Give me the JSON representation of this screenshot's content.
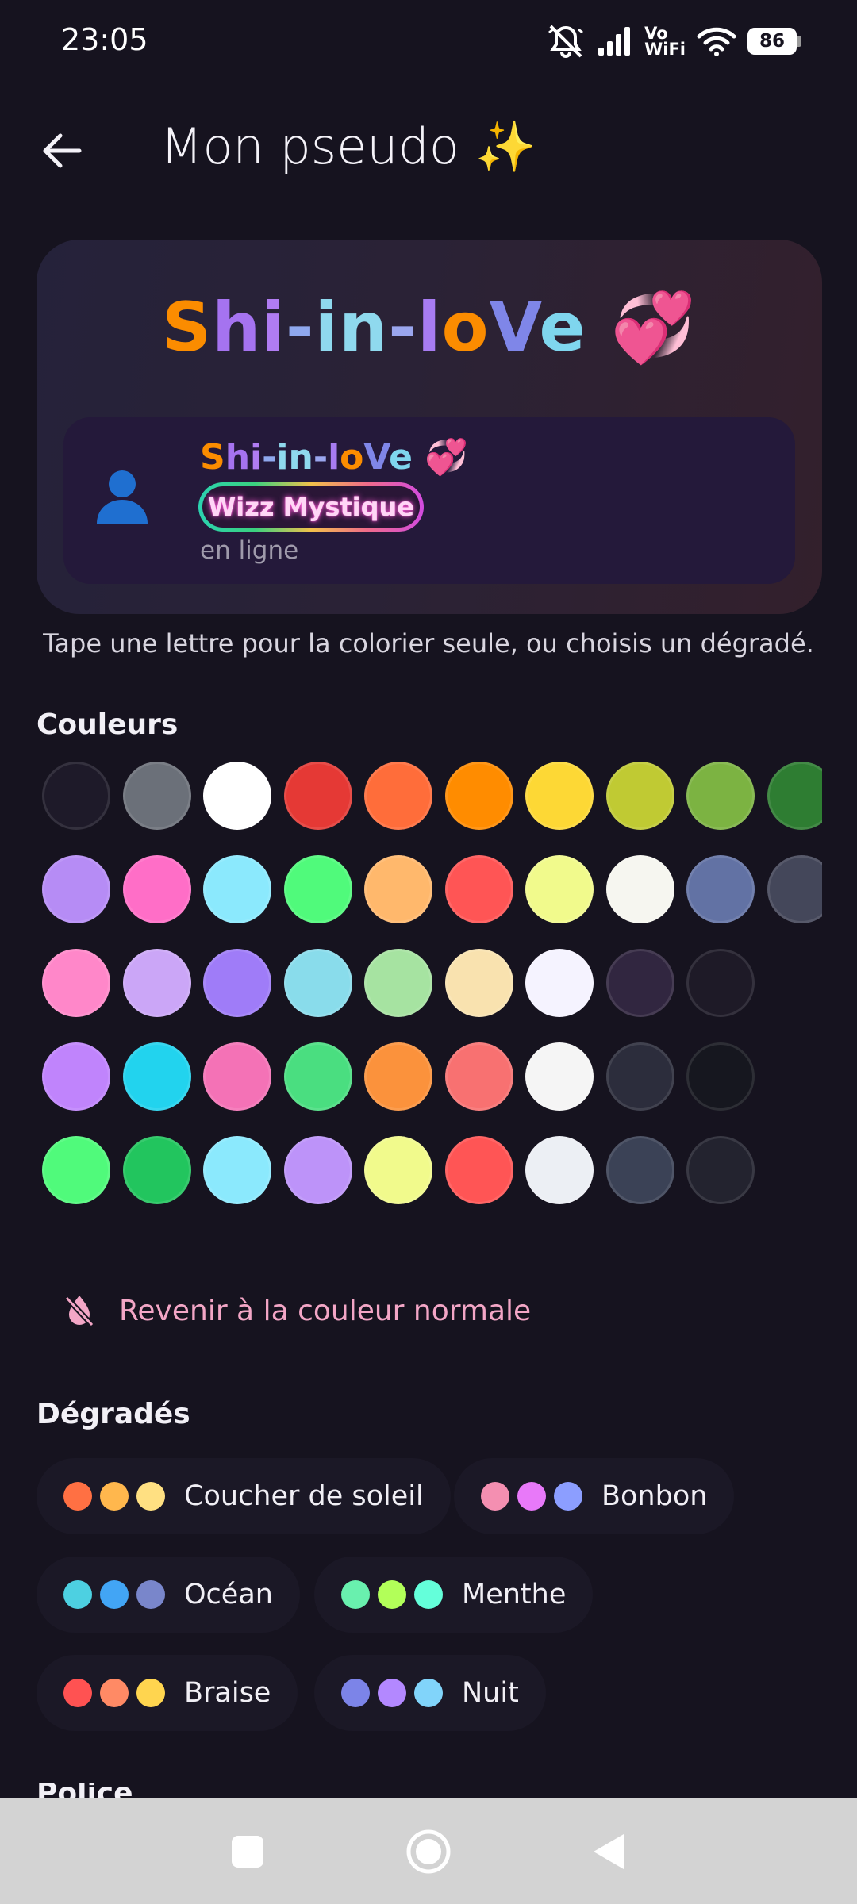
{
  "status_bar": {
    "time": "23:05",
    "volte_top": "Vo",
    "volte_bottom": "WiFi",
    "battery": "86",
    "icons": [
      "mute-icon",
      "signal-icon",
      "wifi-icon",
      "battery-icon"
    ]
  },
  "app_bar": {
    "back_icon": "arrow-left-icon",
    "title": "Mon pseudo ✨"
  },
  "preview": {
    "nickname_letters": [
      {
        "char": "S",
        "color": "#fb8c00"
      },
      {
        "char": "h",
        "color": "#a573f0"
      },
      {
        "char": "i",
        "color": "#b07cf2"
      },
      {
        "char": "-",
        "color": "#8fa8ee"
      },
      {
        "char": "i",
        "color": "#8fd9ee"
      },
      {
        "char": "n",
        "color": "#8fd9ee"
      },
      {
        "char": "-",
        "color": "#9aa6ee"
      },
      {
        "char": "l",
        "color": "#a77cf2"
      },
      {
        "char": "o",
        "color": "#fb8c00"
      },
      {
        "char": "V",
        "color": "#7f86e8"
      },
      {
        "char": "e",
        "color": "#7fd6ee"
      }
    ],
    "nickname_emoji": "💞",
    "avatar_icon": "user-silhouette-icon",
    "badge": "Wizz Mystique",
    "presence": "en ligne"
  },
  "hint": "Tape une lettre pour la colorier seule, ou choisis un dégradé.",
  "colors_section": {
    "title": "Couleurs",
    "rows": [
      [
        "#1e1a29",
        "#6b7079",
        "#ffffff",
        "#e53935",
        "#ff6d3a",
        "#ff8c00",
        "#fdd835",
        "#c0ca33",
        "#7cb342",
        "#2e7d32"
      ],
      [
        "#b68cf5",
        "#ff6ec7",
        "#8be9fd",
        "#50fa7b",
        "#ffb86c",
        "#ff5555",
        "#f1fa8c",
        "#f6f6f0",
        "#6272a4",
        "#44475a"
      ],
      [
        "#ff87c9",
        "#cba6f7",
        "#9f7cf8",
        "#89dceb",
        "#a6e3a1",
        "#f9e2af",
        "#f5f3ff",
        "#312640",
        "#1e1a27"
      ],
      [
        "#c084fc",
        "#22d3ee",
        "#f472b6",
        "#4ade80",
        "#fb923c",
        "#f87171",
        "#f5f5f5",
        "#2c2d3c",
        "#16171f"
      ],
      [
        "#50fa7b",
        "#22c55e",
        "#8be9fd",
        "#bd93f9",
        "#f1fa8c",
        "#ff5555",
        "#eceff4",
        "#3b4256",
        "#23232f"
      ]
    ],
    "reset_icon": "format-color-reset-icon",
    "reset_label": "Revenir à la couleur normale"
  },
  "gradients_section": {
    "title": "Dégradés",
    "chips": [
      {
        "label": "Coucher de soleil",
        "dots": [
          "#ff7043",
          "#ffb74d",
          "#ffe082"
        ]
      },
      {
        "label": "Bonbon",
        "dots": [
          "#f48fb1",
          "#e879f9",
          "#8c9eff"
        ]
      },
      {
        "label": "Océan",
        "dots": [
          "#4dd0e1",
          "#42a5f5",
          "#7986cb"
        ]
      },
      {
        "label": "Menthe",
        "dots": [
          "#69f0ae",
          "#b2ff59",
          "#64ffda"
        ]
      },
      {
        "label": "Braise",
        "dots": [
          "#ff5252",
          "#ff8a65",
          "#ffd54f"
        ]
      },
      {
        "label": "Nuit",
        "dots": [
          "#7c84e8",
          "#b388ff",
          "#81d4fa"
        ]
      }
    ]
  },
  "next_section": {
    "title": "Police"
  },
  "nav_bar": {
    "icons": [
      "recent-apps-icon",
      "home-icon",
      "back-triangle-icon"
    ]
  }
}
